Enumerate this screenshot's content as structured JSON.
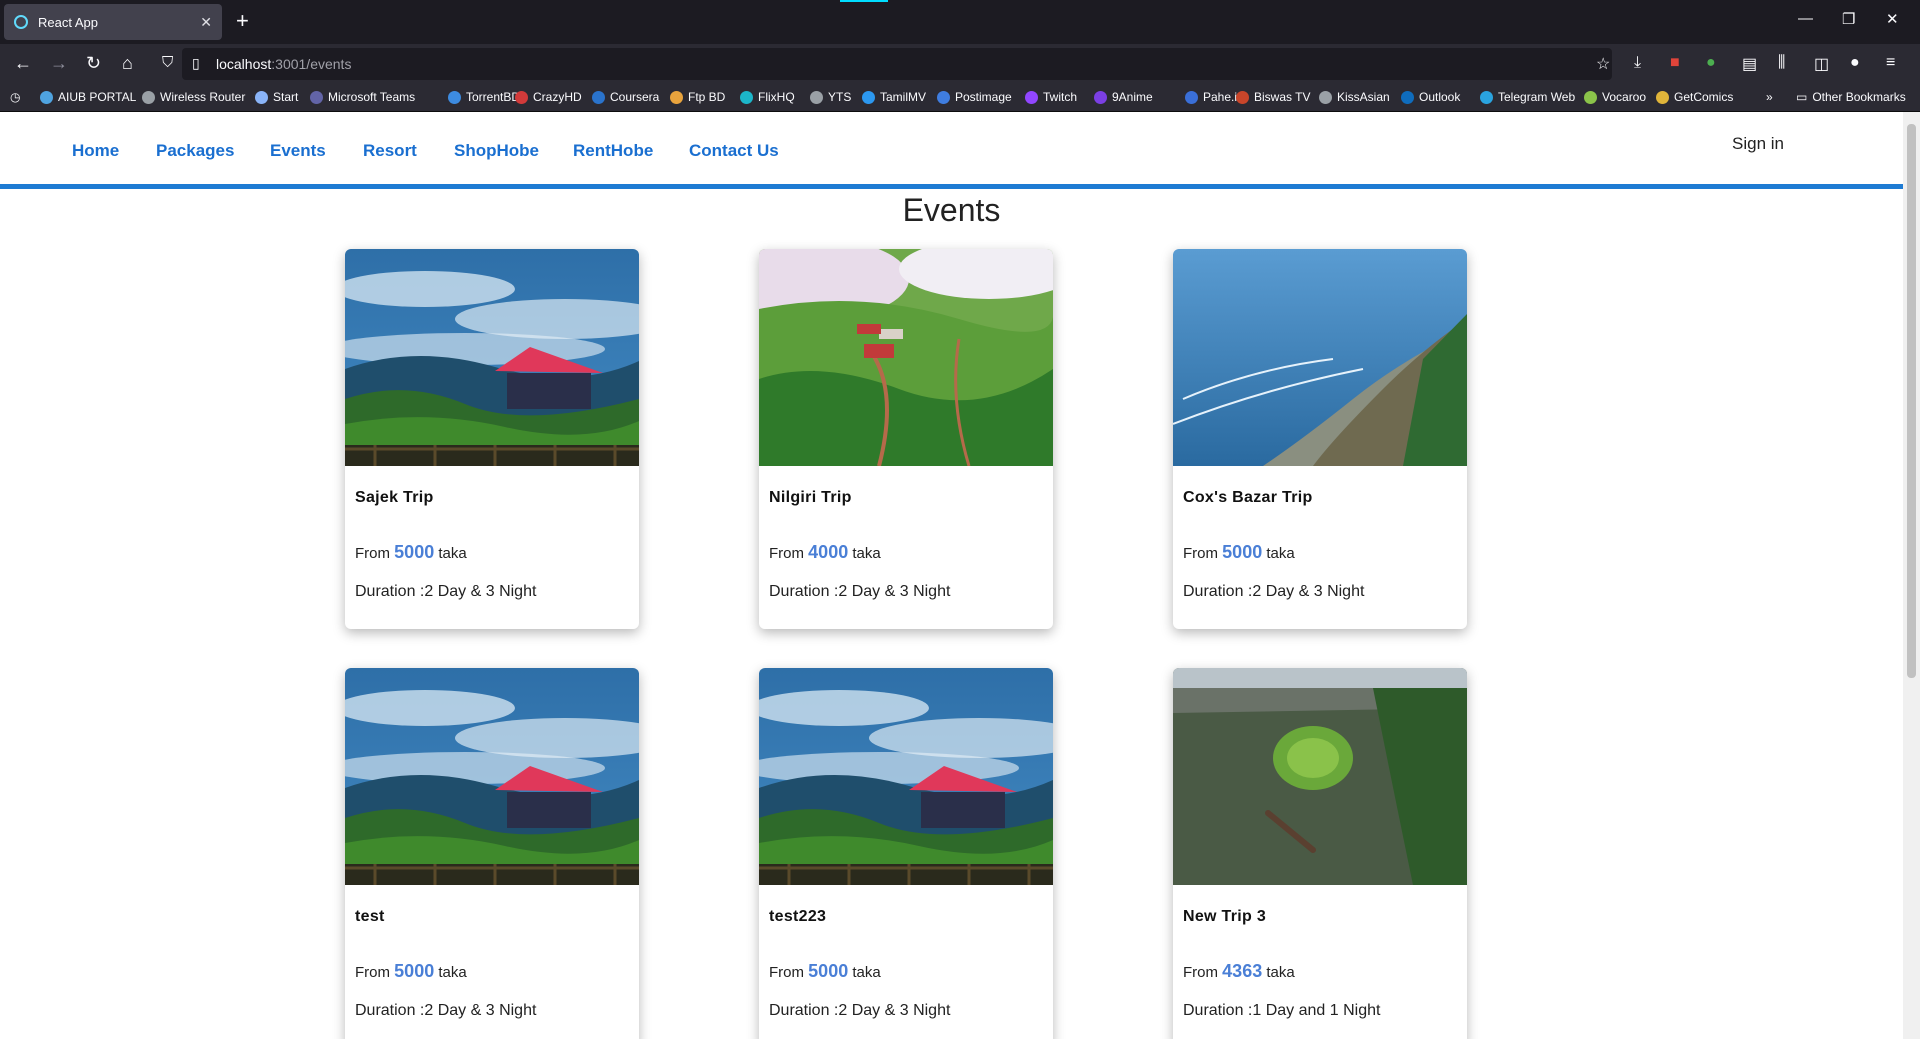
{
  "browser": {
    "tab_title": "React App",
    "url_host": "localhost",
    "url_rest": ":3001/events",
    "bookmarks": [
      {
        "label": "AIUB PORTAL",
        "color": "#4fa3e0"
      },
      {
        "label": "Wireless Router",
        "color": "#9aa0a6"
      },
      {
        "label": "Start",
        "color": "#8ab4f8"
      },
      {
        "label": "Microsoft Teams",
        "color": "#6264a7"
      },
      {
        "label": "TorrentBD",
        "color": "#3d8be0"
      },
      {
        "label": "CrazyHD",
        "color": "#d23a3a"
      },
      {
        "label": "Coursera",
        "color": "#2a73cc"
      },
      {
        "label": "Ftp BD",
        "color": "#e8a33d"
      },
      {
        "label": "FlixHQ",
        "color": "#1cb5c9"
      },
      {
        "label": "YTS",
        "color": "#9aa0a6"
      },
      {
        "label": "TamilMV",
        "color": "#2c98f0"
      },
      {
        "label": "Postimage",
        "color": "#3f7de0"
      },
      {
        "label": "Twitch",
        "color": "#9146ff"
      },
      {
        "label": "9Anime",
        "color": "#7b3fe4"
      },
      {
        "label": "Pahe.in",
        "color": "#3a6fd8"
      },
      {
        "label": "Biswas TV",
        "color": "#c8452a"
      },
      {
        "label": "KissAsian",
        "color": "#9aa0a6"
      },
      {
        "label": "Outlook",
        "color": "#0f6cbd"
      },
      {
        "label": "Telegram Web",
        "color": "#2aa3df"
      },
      {
        "label": "Vocaroo",
        "color": "#8bc34a"
      },
      {
        "label": "GetComics",
        "color": "#e0b43a"
      }
    ],
    "other_bookmarks": "Other Bookmarks"
  },
  "site_nav": {
    "links": [
      "Home",
      "Packages",
      "Events",
      "Resort",
      "ShopHobe",
      "RentHobe",
      "Contact Us"
    ],
    "signin": "Sign in"
  },
  "page": {
    "title": "Events",
    "from_label": "From",
    "currency": "taka"
  },
  "events": [
    {
      "name": "Sajek Trip",
      "price": "5000",
      "duration": "Duration :2 Day & 3 Night",
      "image": "sajek"
    },
    {
      "name": "Nilgiri Trip",
      "price": "4000",
      "duration": "Duration :2 Day & 3 Night",
      "image": "nilgiri"
    },
    {
      "name": "Cox's Bazar Trip",
      "price": "5000",
      "duration": "Duration :2 Day & 3 Night",
      "image": "coxs"
    },
    {
      "name": "test",
      "price": "5000",
      "duration": "Duration :2 Day & 3 Night",
      "image": "sajek"
    },
    {
      "name": "test223",
      "price": "5000",
      "duration": "Duration :2 Day & 3 Night",
      "image": "sajek"
    },
    {
      "name": "New Trip 3",
      "price": "4363",
      "duration": "Duration :1 Day and 1 Night",
      "image": "river"
    }
  ]
}
